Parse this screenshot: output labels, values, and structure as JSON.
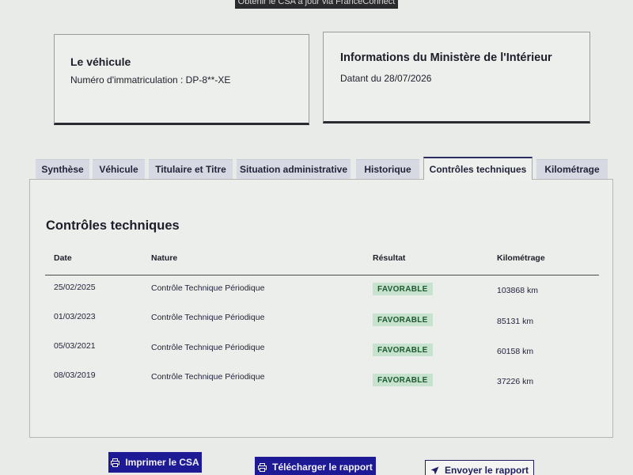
{
  "top_button": {
    "label": "Obtenir le CSA à jour via FranceConnect"
  },
  "vehicle_card": {
    "title": "Le véhicule",
    "registration": "Numéro d'immatriculation : DP-8**-XE"
  },
  "ministry_card": {
    "title": "Informations du Ministère de l'Intérieur",
    "date": "Datant du 28/07/2026"
  },
  "tabs": [
    {
      "label": "Synthèse"
    },
    {
      "label": "Véhicule"
    },
    {
      "label": "Titulaire et Titre"
    },
    {
      "label": "Situation administrative"
    },
    {
      "label": "Historique"
    },
    {
      "label": "Contrôles techniques",
      "active": true
    },
    {
      "label": "Kilométrage"
    }
  ],
  "panel": {
    "title": "Contrôles techniques",
    "columns": {
      "date": "Date",
      "nature": "Nature",
      "result": "Résultat",
      "mileage": "Kilométrage"
    },
    "rows": [
      {
        "date": "25/02/2025",
        "nature": "Contrôle Technique Périodique",
        "result": "FAVORABLE",
        "mileage": "103868 km"
      },
      {
        "date": "01/03/2023",
        "nature": "Contrôle Technique Périodique",
        "result": "FAVORABLE",
        "mileage": "85131 km"
      },
      {
        "date": "05/03/2021",
        "nature": "Contrôle Technique Périodique",
        "result": "FAVORABLE",
        "mileage": "60158 km"
      },
      {
        "date": "08/03/2019",
        "nature": "Contrôle Technique Périodique",
        "result": "FAVORABLE",
        "mileage": "37226 km"
      }
    ]
  },
  "actions": {
    "print": {
      "label": "Imprimer le CSA",
      "icon": "printer-icon"
    },
    "download": {
      "label": "Télécharger le rapport",
      "icon": "printer-icon"
    },
    "send": {
      "label": "Envoyer le rapport",
      "icon": "send-icon"
    }
  },
  "colors": {
    "primary": "#1e1a96",
    "badge_bg": "#c7e2cf",
    "badge_text": "#1c5a2e",
    "active_tab_border": "#2d2d62"
  }
}
